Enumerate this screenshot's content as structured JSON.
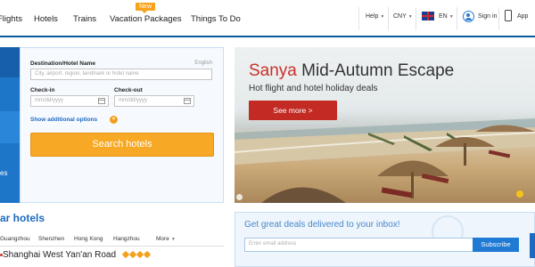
{
  "nav": {
    "items": [
      "Flights",
      "Hotels",
      "Trains",
      "Vacation Packages",
      "Things To Do"
    ],
    "new_badge": "New"
  },
  "utility": {
    "help": "Help",
    "currency": "CNY",
    "language": "EN",
    "sign_in": "Sign in",
    "app": "App"
  },
  "search": {
    "side_tab_text": "es",
    "destination_label": "Destination/Hotel Name",
    "language_hint": "English",
    "destination_placeholder": "City, airport, region, landmark or hotel name",
    "checkin_label": "Check-in",
    "checkout_label": "Check-out",
    "date_placeholder": "mm/dd/yyyy",
    "additional_options": "Show additional options",
    "button": "Search hotels"
  },
  "banner": {
    "title_red": "Sanya",
    "title_rest": " Mid-Autumn Escape",
    "subtitle": "Hot flight and hotel holiday deals",
    "cta": "See more >"
  },
  "similar": {
    "title": "ar hotels",
    "filters": [
      "Guangzhou",
      "Shenzhen",
      "Hong Kong",
      "Hangzhou",
      "More"
    ],
    "hotel_name": "Shanghai West Yan'an Road",
    "rating_diamonds": 4
  },
  "deals": {
    "title": "Get great deals delivered to your inbox!",
    "email_placeholder": "Enter email address",
    "subscribe": "Subscribe"
  },
  "colors": {
    "brand_blue": "#1d69c0",
    "accent_orange": "#f7a824",
    "cta_red": "#c22a23"
  }
}
